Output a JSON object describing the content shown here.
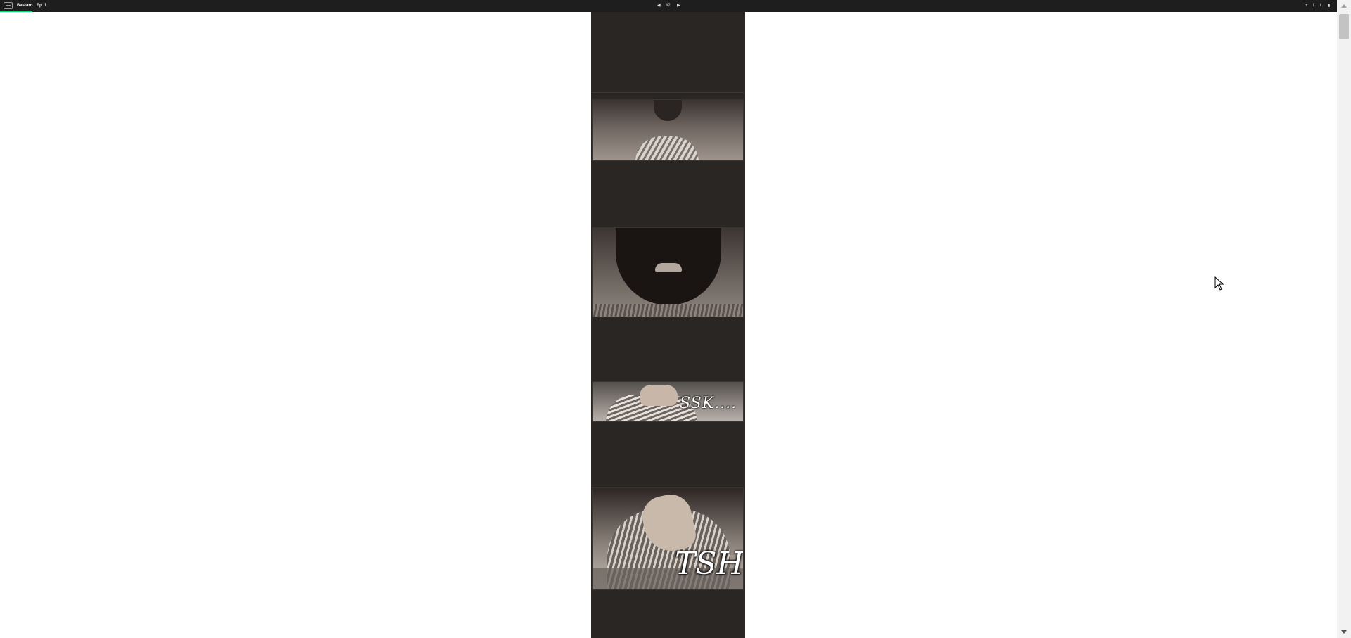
{
  "topbar": {
    "series_title": "Bastard",
    "separator": "›",
    "episode_label": "Ep. 1",
    "progress_percent": 2.4,
    "accent_color": "#00dc64"
  },
  "pager": {
    "prev_icon": "◀",
    "current": "#2",
    "next_icon": "▶"
  },
  "header_actions": {
    "add_icon": "+",
    "facebook_icon": "f",
    "twitter_icon": "t",
    "save_icon": "▮"
  },
  "comic_strip": {
    "panel_3_sfx": "SSK....",
    "panel_4_sfx": "TSH",
    "background_color": "#2a2623"
  },
  "icons": [
    "webtoon-logo-icon",
    "prev-arrow-icon",
    "next-arrow-icon",
    "add-icon",
    "facebook-icon",
    "twitter-icon",
    "bookmark-icon",
    "mouse-cursor-icon"
  ]
}
